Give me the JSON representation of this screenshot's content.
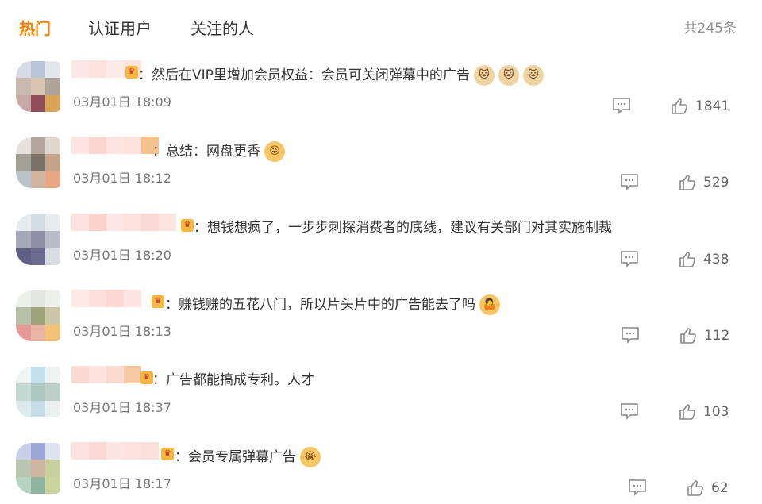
{
  "tabs": [
    {
      "label": "热门"
    },
    {
      "label": "认证用户"
    },
    {
      "label": "关注的人"
    }
  ],
  "total_count": "共245条",
  "colors": {
    "accent": "#ff8200",
    "badge": "#f5b642"
  },
  "comments": [
    {
      "text": "：然后在VIP里增加会员权益：会员可关闭弹幕中的广告",
      "emojis": [
        "cat-face",
        "cat-face",
        "cat-face"
      ],
      "time": "03月01日 18:09",
      "likes": "1841"
    },
    {
      "text": "：总结：网盘更香",
      "emojis": [
        "grinning-rainbow-face"
      ],
      "time": "03月01日 18:12",
      "likes": "529"
    },
    {
      "text": "：想钱想疯了，一步步刺探消费者的底线，建议有关部门对其实施制裁",
      "emojis": [],
      "time": "03月01日 18:20",
      "likes": "438"
    },
    {
      "text": "：赚钱赚的五花八门，所以片头片中的广告能去了吗",
      "emojis": [
        "shrug-face"
      ],
      "time": "03月01日 18:13",
      "likes": "112"
    },
    {
      "text": "：广告都能搞成专利。人才",
      "emojis": [],
      "time": "03月01日 18:37",
      "likes": "103"
    },
    {
      "text": "：会员专属弹幕广告",
      "emojis": [
        "crying-face"
      ],
      "time": "03月01日 18:17",
      "likes": "62"
    }
  ]
}
